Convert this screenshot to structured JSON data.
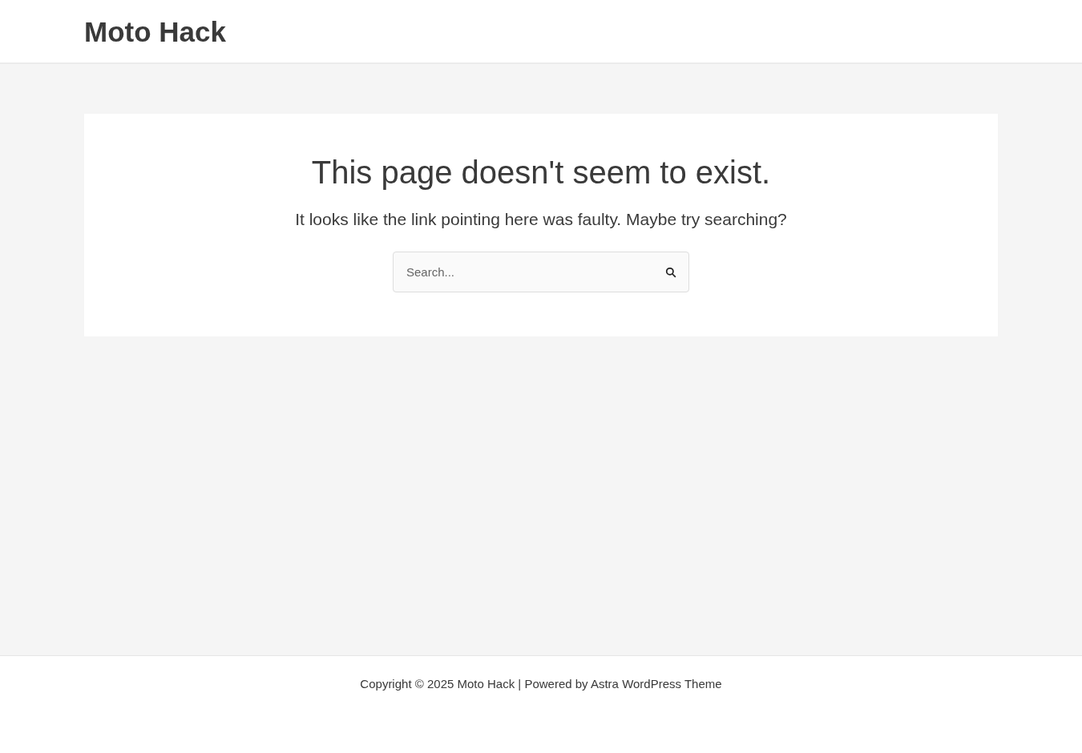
{
  "header": {
    "site_title": "Moto Hack"
  },
  "content": {
    "title": "This page doesn't seem to exist.",
    "message": "It looks like the link pointing here was faulty. Maybe try searching?",
    "search": {
      "placeholder": "Search..."
    }
  },
  "footer": {
    "text": "Copyright © 2025 Moto Hack | Powered by Astra WordPress Theme"
  }
}
